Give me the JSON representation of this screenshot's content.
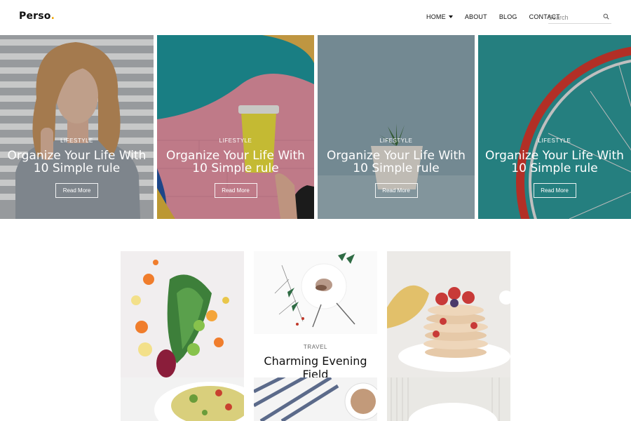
{
  "header": {
    "logo": "Perso",
    "logo_dot": ".",
    "nav": [
      {
        "label": "HOME",
        "has_dropdown": true
      },
      {
        "label": "ABOUT"
      },
      {
        "label": "BLOG"
      },
      {
        "label": "CONTACT"
      }
    ],
    "search": {
      "placeholder": "Search",
      "icon": "search-icon"
    }
  },
  "hero": {
    "cards": [
      {
        "category": "LIFESTYLE",
        "title": "Organize Your Life With 10 Simple rule",
        "button": "Read More"
      },
      {
        "category": "LIFESTYLE",
        "title": "Organize Your Life With 10 Simple rule",
        "button": "Read More"
      },
      {
        "category": "LIFESTYLE",
        "title": "Organize Your Life With 10 Simple rule",
        "button": "Read More"
      },
      {
        "category": "LIFESTYLE",
        "title": "Organize Your Life With 10 Simple rule",
        "button": "Read More"
      }
    ]
  },
  "grid": {
    "featured": {
      "category": "TRAVEL",
      "title": "Charming Evening Field"
    }
  },
  "colors": {
    "accent_dot": "#f0a500",
    "text": "#111111"
  }
}
